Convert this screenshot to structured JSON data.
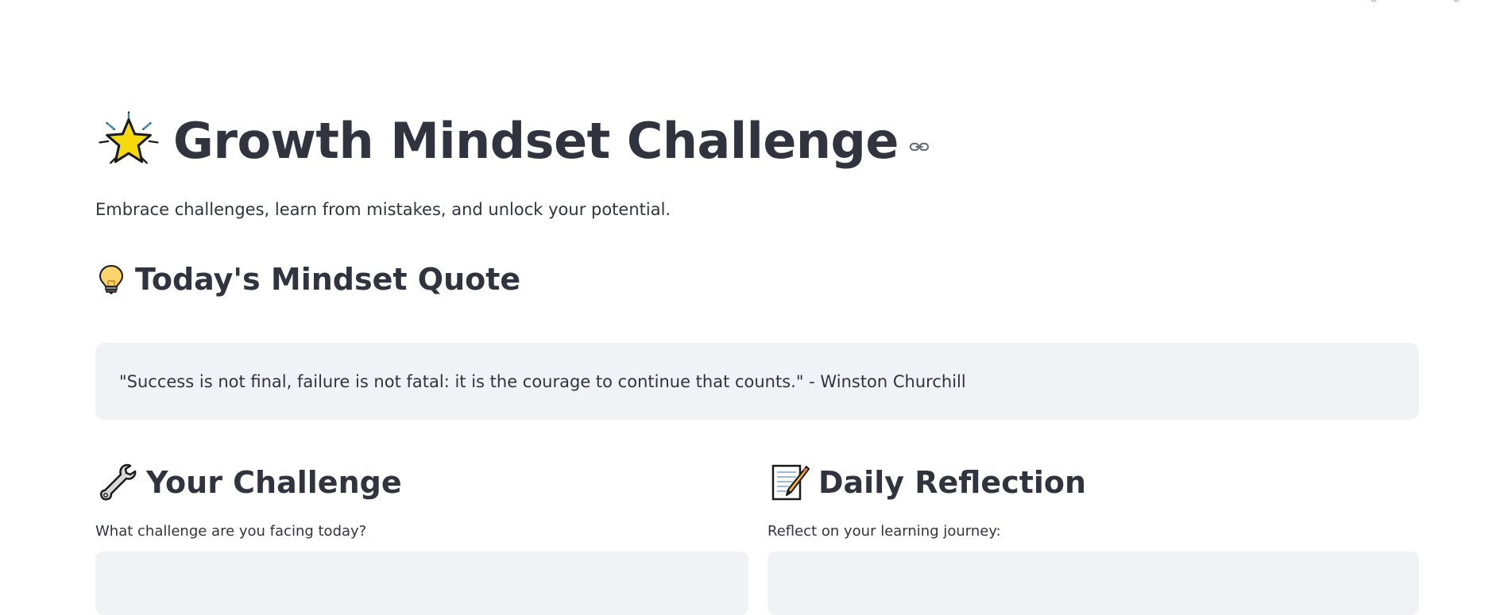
{
  "app": {
    "title": "Growth Mindset Challenge",
    "subtitle": "Embrace challenges, learn from mistakes, and unlock your potential."
  },
  "quote_section": {
    "heading": "Today's Mindset Quote",
    "icon": "lightbulb-icon",
    "quote": "\"Success is not final, failure is not fatal: it is the courage to continue that counts.\" - Winston Churchill"
  },
  "challenge_section": {
    "heading": "Your Challenge",
    "icon": "wrench-icon",
    "label": "What challenge are you facing today?",
    "value": ""
  },
  "reflection_section": {
    "heading": "Daily Reflection",
    "icon": "memo-icon",
    "label": "Reflect on your learning journey:",
    "value": ""
  },
  "colors": {
    "text": "#31333f",
    "panel_bg": "#f0f2f6",
    "star_fill": "#f5d90a",
    "star_burst": "#3bb8e8"
  }
}
